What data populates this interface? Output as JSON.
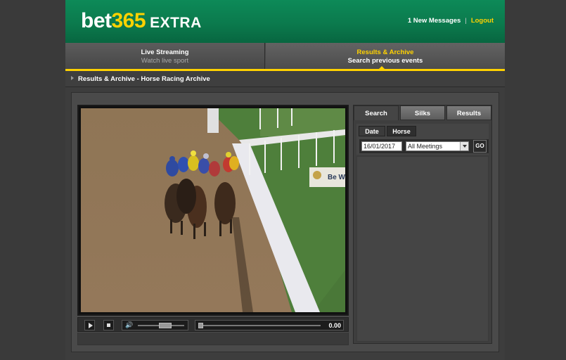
{
  "header": {
    "logo_part1": "bet",
    "logo_part2": "365",
    "logo_part3": "EXTRA",
    "messages_link": "1 New Messages",
    "separator": "|",
    "logout_link": "Logout"
  },
  "nav": {
    "tabs": [
      {
        "title": "Live Streaming",
        "subtitle": "Watch live sport",
        "active": false
      },
      {
        "title": "Results & Archive",
        "subtitle": "Search previous events",
        "active": true
      }
    ]
  },
  "breadcrumb": {
    "text": "Results & Archive - Horse Racing Archive"
  },
  "video": {
    "description_icon": "horse-race-video",
    "signage_text": "Be W",
    "time": "0.00",
    "volume_level": 0.62,
    "progress": 0.0
  },
  "side_panel": {
    "tabs": [
      "Search",
      "Silks",
      "Results"
    ],
    "active_tab": "Search",
    "sub_tabs": [
      "Date",
      "Horse"
    ],
    "active_sub_tab": "Date",
    "date_value": "16/01/2017",
    "meeting_select": "All Meetings",
    "go_label": "GO"
  },
  "colors": {
    "brand_green": "#0b7a4d",
    "brand_yellow": "#ffd200",
    "background": "#3a3a3a"
  }
}
